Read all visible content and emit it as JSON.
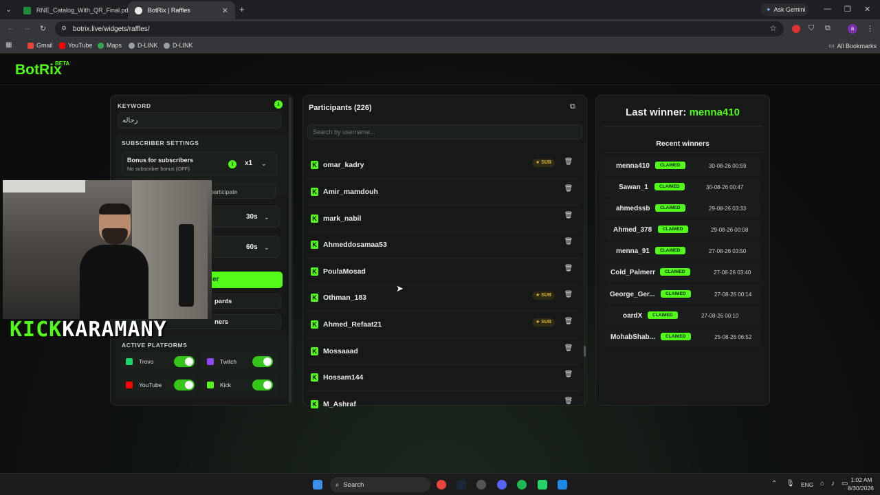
{
  "browser": {
    "tabs": [
      {
        "label": "RNE_Catalog_With_QR_Final.pd",
        "active": false
      },
      {
        "label": "BotRix | Raffles",
        "active": true
      }
    ],
    "new_tab": "+",
    "ask_gemini": "Ask Gemini",
    "url": "botrix.live/widgets/raffles/",
    "avatar_letter": "a",
    "bookmarks": [
      "Gmail",
      "YouTube",
      "Maps",
      "D-LINK",
      "D-LINK"
    ],
    "all_bookmarks": "All Bookmarks"
  },
  "app": {
    "logo": "BotRix",
    "logo_badge": "BETA",
    "accent": "#53fc18"
  },
  "settings": {
    "keyword_label": "KEYWORD",
    "keyword_value": "رحاله",
    "info_icon": "i",
    "subscriber_settings_label": "SUBSCRIBER SETTINGS",
    "bonus_title": "Bonus for subscribers",
    "bonus_sub": "No subscriber bonus (OFF)",
    "bonus_multiplier": "x1",
    "participate_partial": "participate",
    "timer1": "30s",
    "timer2": "60s",
    "green_button_partial": "er",
    "btn2_partial": "pants",
    "btn3_partial": "ners",
    "active_platforms_label": "ACTIVE PLATFORMS",
    "platforms": [
      "Trovo",
      "Twitch",
      "YouTube",
      "Kick"
    ]
  },
  "participants": {
    "title": "Participants (226)",
    "search_placeholder": "Search by username...",
    "sub_badge": "SUB",
    "rows": [
      {
        "name": "omar_kadry",
        "sub": true
      },
      {
        "name": "Amir_mamdouh",
        "sub": false
      },
      {
        "name": "mark_nabil",
        "sub": false
      },
      {
        "name": "Ahmeddosamaa53",
        "sub": false
      },
      {
        "name": "PoulaMosad",
        "sub": false
      },
      {
        "name": "Othman_183",
        "sub": true
      },
      {
        "name": "Ahmed_Refaat21",
        "sub": true
      },
      {
        "name": "Mossaaad",
        "sub": false
      },
      {
        "name": "Hossam144",
        "sub": false
      },
      {
        "name": "M_Ashraf",
        "sub": false
      }
    ]
  },
  "winners": {
    "last_winner_label": "Last winner:",
    "last_winner_name": "menna410",
    "recent_label": "Recent winners",
    "claimed": "CLAIMED",
    "rows": [
      {
        "name": "menna410",
        "date": "30-08-26 00:59"
      },
      {
        "name": "Sawan_1",
        "date": "30-08-26 00:47"
      },
      {
        "name": "ahmedssb",
        "date": "29-08-26 03:33"
      },
      {
        "name": "Ahmed_378",
        "date": "29-08-26 00:08"
      },
      {
        "name": "menna_91",
        "date": "27-08-26 03:50"
      },
      {
        "name": "Cold_Palmerr",
        "date": "27-08-26 03:40"
      },
      {
        "name": "George_Ger...",
        "date": "27-08-26 00:14"
      },
      {
        "name": "oardX",
        "date": "27-08-26 00:10"
      },
      {
        "name": "MohabShab...",
        "date": "25-08-26 06:52"
      }
    ]
  },
  "overlay": {
    "kick_word": "KICK",
    "name_word": "KARAMANY"
  },
  "taskbar": {
    "search": "Search",
    "lang": "ENG",
    "time": "1:02 AM",
    "date": "8/30/2026"
  }
}
